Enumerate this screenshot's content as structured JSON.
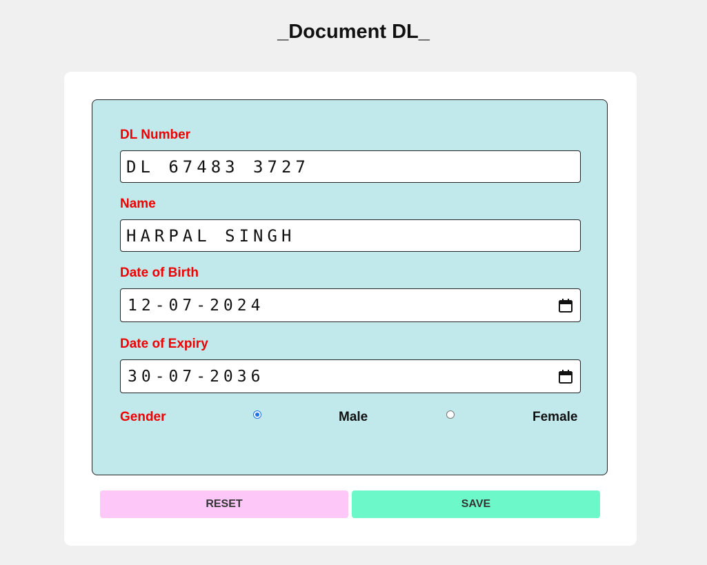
{
  "page": {
    "title": "_Document DL_"
  },
  "form": {
    "dl_number": {
      "label": "DL Number",
      "value": "DL 67483 3727"
    },
    "name": {
      "label": "Name",
      "value": "HARPAL SINGH"
    },
    "date_of_birth": {
      "label": "Date of Birth",
      "value": "12-07-2024"
    },
    "date_of_expiry": {
      "label": "Date of Expiry",
      "value": "30-07-2036"
    },
    "gender": {
      "label": "Gender",
      "options": [
        {
          "label": "Male",
          "selected": true
        },
        {
          "label": "Female",
          "selected": false
        }
      ]
    }
  },
  "actions": {
    "reset_label": "RESET",
    "save_label": "SAVE"
  },
  "colors": {
    "page_background": "#f0f0f0",
    "panel_background": "#c1e8ea",
    "label_color": "#ee0000",
    "reset_button": "#fdc8f8",
    "save_button": "#6cf8c9",
    "radio_accent": "#1a73e8"
  },
  "icons": {
    "date_picker": "calendar-icon"
  }
}
